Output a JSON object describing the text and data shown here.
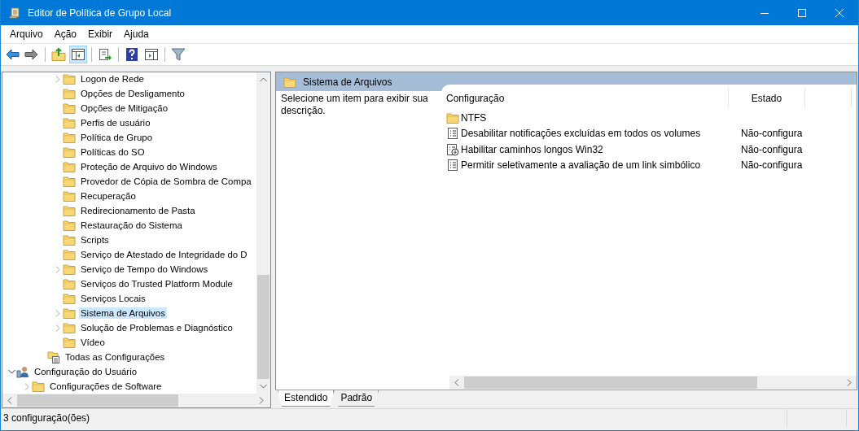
{
  "window": {
    "title": "Editor de Política de Grupo Local"
  },
  "menu": [
    "Arquivo",
    "Ação",
    "Exibir",
    "Ajuda"
  ],
  "toolbar": [
    {
      "kind": "back",
      "pressed": false
    },
    {
      "kind": "forward",
      "pressed": false
    },
    {
      "kind": "sep"
    },
    {
      "kind": "up",
      "pressed": false
    },
    {
      "kind": "tree",
      "pressed": true
    },
    {
      "kind": "sep"
    },
    {
      "kind": "export",
      "pressed": false
    },
    {
      "kind": "sep"
    },
    {
      "kind": "help",
      "pressed": false
    },
    {
      "kind": "view",
      "pressed": false
    },
    {
      "kind": "sep"
    },
    {
      "kind": "filter",
      "pressed": false
    }
  ],
  "tree": {
    "items": [
      {
        "children": [
          {
            "children": [
              {
                "children": [
                  {
                    "label": "Logon de Rede",
                    "kind": "folder",
                    "has_children": true,
                    "expanded": false,
                    "selected": false
                  },
                  {
                    "label": "Opções de Desligamento",
                    "kind": "folder",
                    "has_children": false,
                    "selected": false
                  },
                  {
                    "label": "Opções de Mitigação",
                    "kind": "folder",
                    "has_children": false,
                    "selected": false
                  },
                  {
                    "label": "Perfis de usuário",
                    "kind": "folder",
                    "has_children": false,
                    "selected": false
                  },
                  {
                    "label": "Política de Grupo",
                    "kind": "folder",
                    "has_children": false,
                    "selected": false
                  },
                  {
                    "label": "Políticas do SO",
                    "kind": "folder",
                    "has_children": false,
                    "selected": false
                  },
                  {
                    "label": "Proteção de Arquivo do Windows",
                    "kind": "folder",
                    "has_children": false,
                    "selected": false
                  },
                  {
                    "label": "Provedor de Cópia de Sombra de Compa",
                    "kind": "folder",
                    "has_children": false,
                    "selected": false
                  },
                  {
                    "label": "Recuperação",
                    "kind": "folder",
                    "has_children": false,
                    "selected": false
                  },
                  {
                    "label": "Redirecionamento de Pasta",
                    "kind": "folder",
                    "has_children": false,
                    "selected": false
                  },
                  {
                    "label": "Restauração do Sistema",
                    "kind": "folder",
                    "has_children": false,
                    "selected": false
                  },
                  {
                    "label": "Scripts",
                    "kind": "folder",
                    "has_children": false,
                    "selected": false
                  },
                  {
                    "label": "Serviço de Atestado de Integridade do D",
                    "kind": "folder",
                    "has_children": false,
                    "selected": false
                  },
                  {
                    "label": "Serviço de Tempo do Windows",
                    "kind": "folder",
                    "has_children": true,
                    "expanded": false,
                    "selected": false
                  },
                  {
                    "label": "Serviços do Trusted Platform Module",
                    "kind": "folder",
                    "has_children": false,
                    "selected": false
                  },
                  {
                    "label": "Serviços Locais",
                    "kind": "folder",
                    "has_children": false,
                    "selected": false
                  },
                  {
                    "label": "Sistema de Arquivos",
                    "kind": "folder",
                    "has_children": true,
                    "expanded": false,
                    "selected": true
                  },
                  {
                    "label": "Solução de Problemas e Diagnóstico",
                    "kind": "folder",
                    "has_children": true,
                    "expanded": false,
                    "selected": false
                  },
                  {
                    "label": "Vídeo",
                    "kind": "folder",
                    "has_children": false,
                    "selected": false
                  }
                ]
              },
              {
                "label": "Todas as Configurações",
                "kind": "all-settings",
                "has_children": false,
                "selected": false
              }
            ]
          }
        ]
      },
      {
        "label": "Configuração do Usuário",
        "kind": "user",
        "has_children": true,
        "expanded": true,
        "selected": false,
        "children": [
          {
            "label": "Configurações de Software",
            "kind": "folder",
            "has_children": true,
            "expanded": false,
            "selected": false
          }
        ]
      }
    ]
  },
  "details": {
    "header": "Sistema de Arquivos",
    "description": "Selecione um item para exibir sua descrição.",
    "columns": [
      "Configuração",
      "Estado"
    ],
    "rows": [
      {
        "kind": "folder",
        "name": "NTFS"
      },
      {
        "kind": "setting",
        "name": "Desabilitar notificações excluídas em todos os volumes",
        "state": "Não-configura"
      },
      {
        "kind": "setting-alt",
        "name": "Habilitar caminhos longos Win32",
        "state": "Não-configura"
      },
      {
        "kind": "setting",
        "name": "Permitir seletivamente a avaliação de um link simbólico",
        "state": "Não-configura"
      }
    ],
    "tabs": [
      {
        "label": "Estendido",
        "selected": true
      },
      {
        "label": "Padrão",
        "selected": false
      }
    ]
  },
  "status_bar": "3 configuração(ões)"
}
